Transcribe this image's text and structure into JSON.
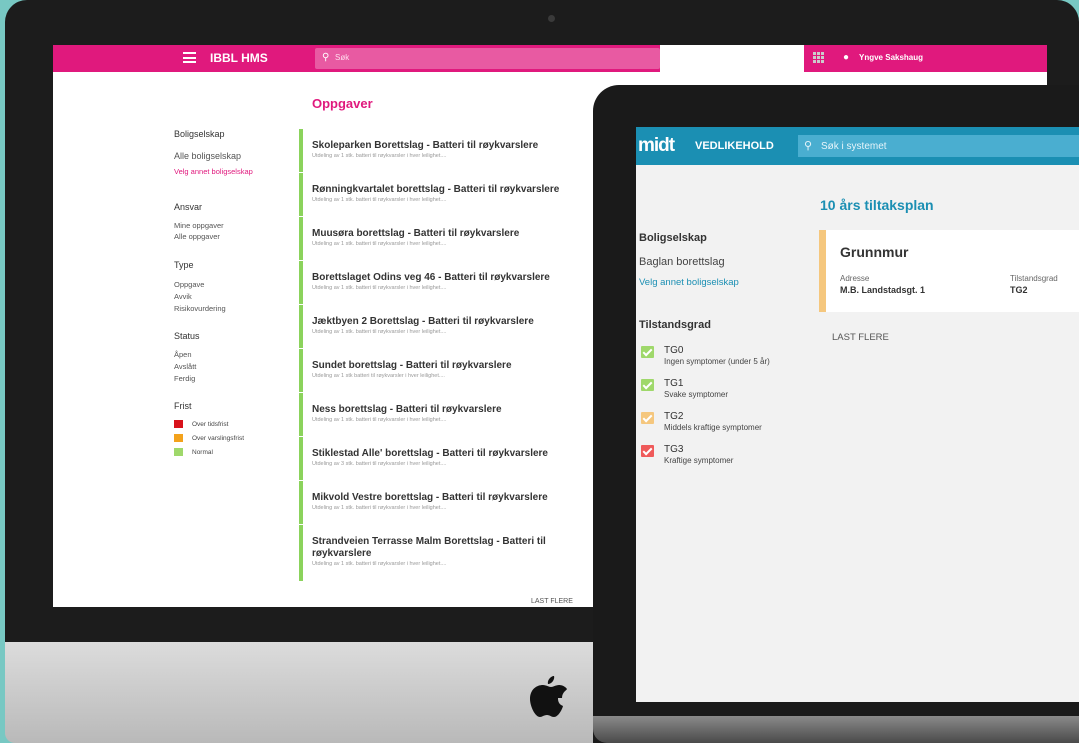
{
  "desktop": {
    "app_title": "IBBL HMS",
    "search_placeholder": "Søk",
    "user_name": "Yngve Sakshaug",
    "page_title": "Oppgaver",
    "filters": {
      "boligselskap": {
        "heading": "Boligselskap",
        "selected": "Alle boligselskap",
        "link": "Velg annet boligselskap"
      },
      "ansvar": {
        "heading": "Ansvar",
        "items": [
          "Mine oppgaver",
          "Alle oppgaver"
        ]
      },
      "type": {
        "heading": "Type",
        "items": [
          "Oppgave",
          "Avvik",
          "Risikovurdering"
        ]
      },
      "status": {
        "heading": "Status",
        "items": [
          "Åpen",
          "Avslått",
          "Ferdig"
        ]
      },
      "frist": {
        "heading": "Frist",
        "items": [
          {
            "label": "Over tidsfrist",
            "color": "#d8121b"
          },
          {
            "label": "Over varslingsfrist",
            "color": "#f3a21c"
          },
          {
            "label": "Normal",
            "color": "#9fd86b"
          }
        ]
      }
    },
    "tasks": [
      {
        "title": "Skoleparken Borettslag - Batteri til røykvarslere",
        "subtitle": "Utdeling av 1 stk. batteri til røykvarsler i hver leilighet...."
      },
      {
        "title": "Rønningkvartalet borettslag - Batteri til røykvarslere",
        "subtitle": "Utdeling av 1 stk. batteri til røykvarsler i hver leilighet...."
      },
      {
        "title": "Muusøra borettslag - Batteri til røykvarslere",
        "subtitle": "Utdeling av 1 stk. batteri til røykvarsler i hver leilighet...."
      },
      {
        "title": "Borettslaget Odins veg 46 - Batteri til røykvarslere",
        "subtitle": "Utdeling av 1 stk. batteri til røykvarsler i hver leilighet...."
      },
      {
        "title": "Jæktbyen 2 Borettslag - Batteri til røykvarslere",
        "subtitle": "Utdeling av 1 stk. batteri til røykvarsler i hver leilighet...."
      },
      {
        "title": "Sundet borettslag - Batteri til røykvarslere",
        "subtitle": "Utdeling av 1 stk batteri til røykvarsler i hver leilighet...."
      },
      {
        "title": "Ness borettslag - Batteri til røykvarslere",
        "subtitle": "Utdeling av 1 stk. batteri til røykvarsler i hver leilighet...."
      },
      {
        "title": "Stiklestad Alle' borettslag - Batteri til røykvarslere",
        "subtitle": "Utdeling av 3 stk. batteri til røykvarsler i hver leilighet...."
      },
      {
        "title": "Mikvold Vestre borettslag - Batteri til røykvarslere",
        "subtitle": "Utdeling av 1 stk. batteri til røykvarsler i hver leilighet...."
      },
      {
        "title": "Strandveien Terrasse Malm Borettslag - Batteri til røykvarslere",
        "subtitle": "Utdeling av 1 stk. batteri til røykvarsler i hver leilighet...."
      }
    ],
    "last_more": "LAST FLERE"
  },
  "laptop": {
    "logo": "midt",
    "section": "VEDLIKEHOLD",
    "search_placeholder": "Søk i systemet",
    "page_title": "10 års tiltaksplan",
    "boligselskap": {
      "heading": "Boligselskap",
      "selected": "Baglan borettslag",
      "link": "Velg annet boligselskap"
    },
    "tilstandsgrad": {
      "heading": "Tilstandsgrad",
      "items": [
        {
          "code": "TG0",
          "desc": "Ingen symptomer (under 5 år)",
          "color": "#9fd86b"
        },
        {
          "code": "TG1",
          "desc": "Svake symptomer",
          "color": "#9fd86b"
        },
        {
          "code": "TG2",
          "desc": "Middels kraftige symptomer",
          "color": "#f5c77e"
        },
        {
          "code": "TG3",
          "desc": "Kraftige symptomer",
          "color": "#ef5a5a"
        }
      ]
    },
    "card": {
      "title": "Grunnmur",
      "address_label": "Adresse",
      "address_value": "M.B. Landstadsgt. 1",
      "grade_label": "Tilstandsgrad",
      "grade_value": "TG2"
    },
    "last_more": "LAST FLERE"
  }
}
